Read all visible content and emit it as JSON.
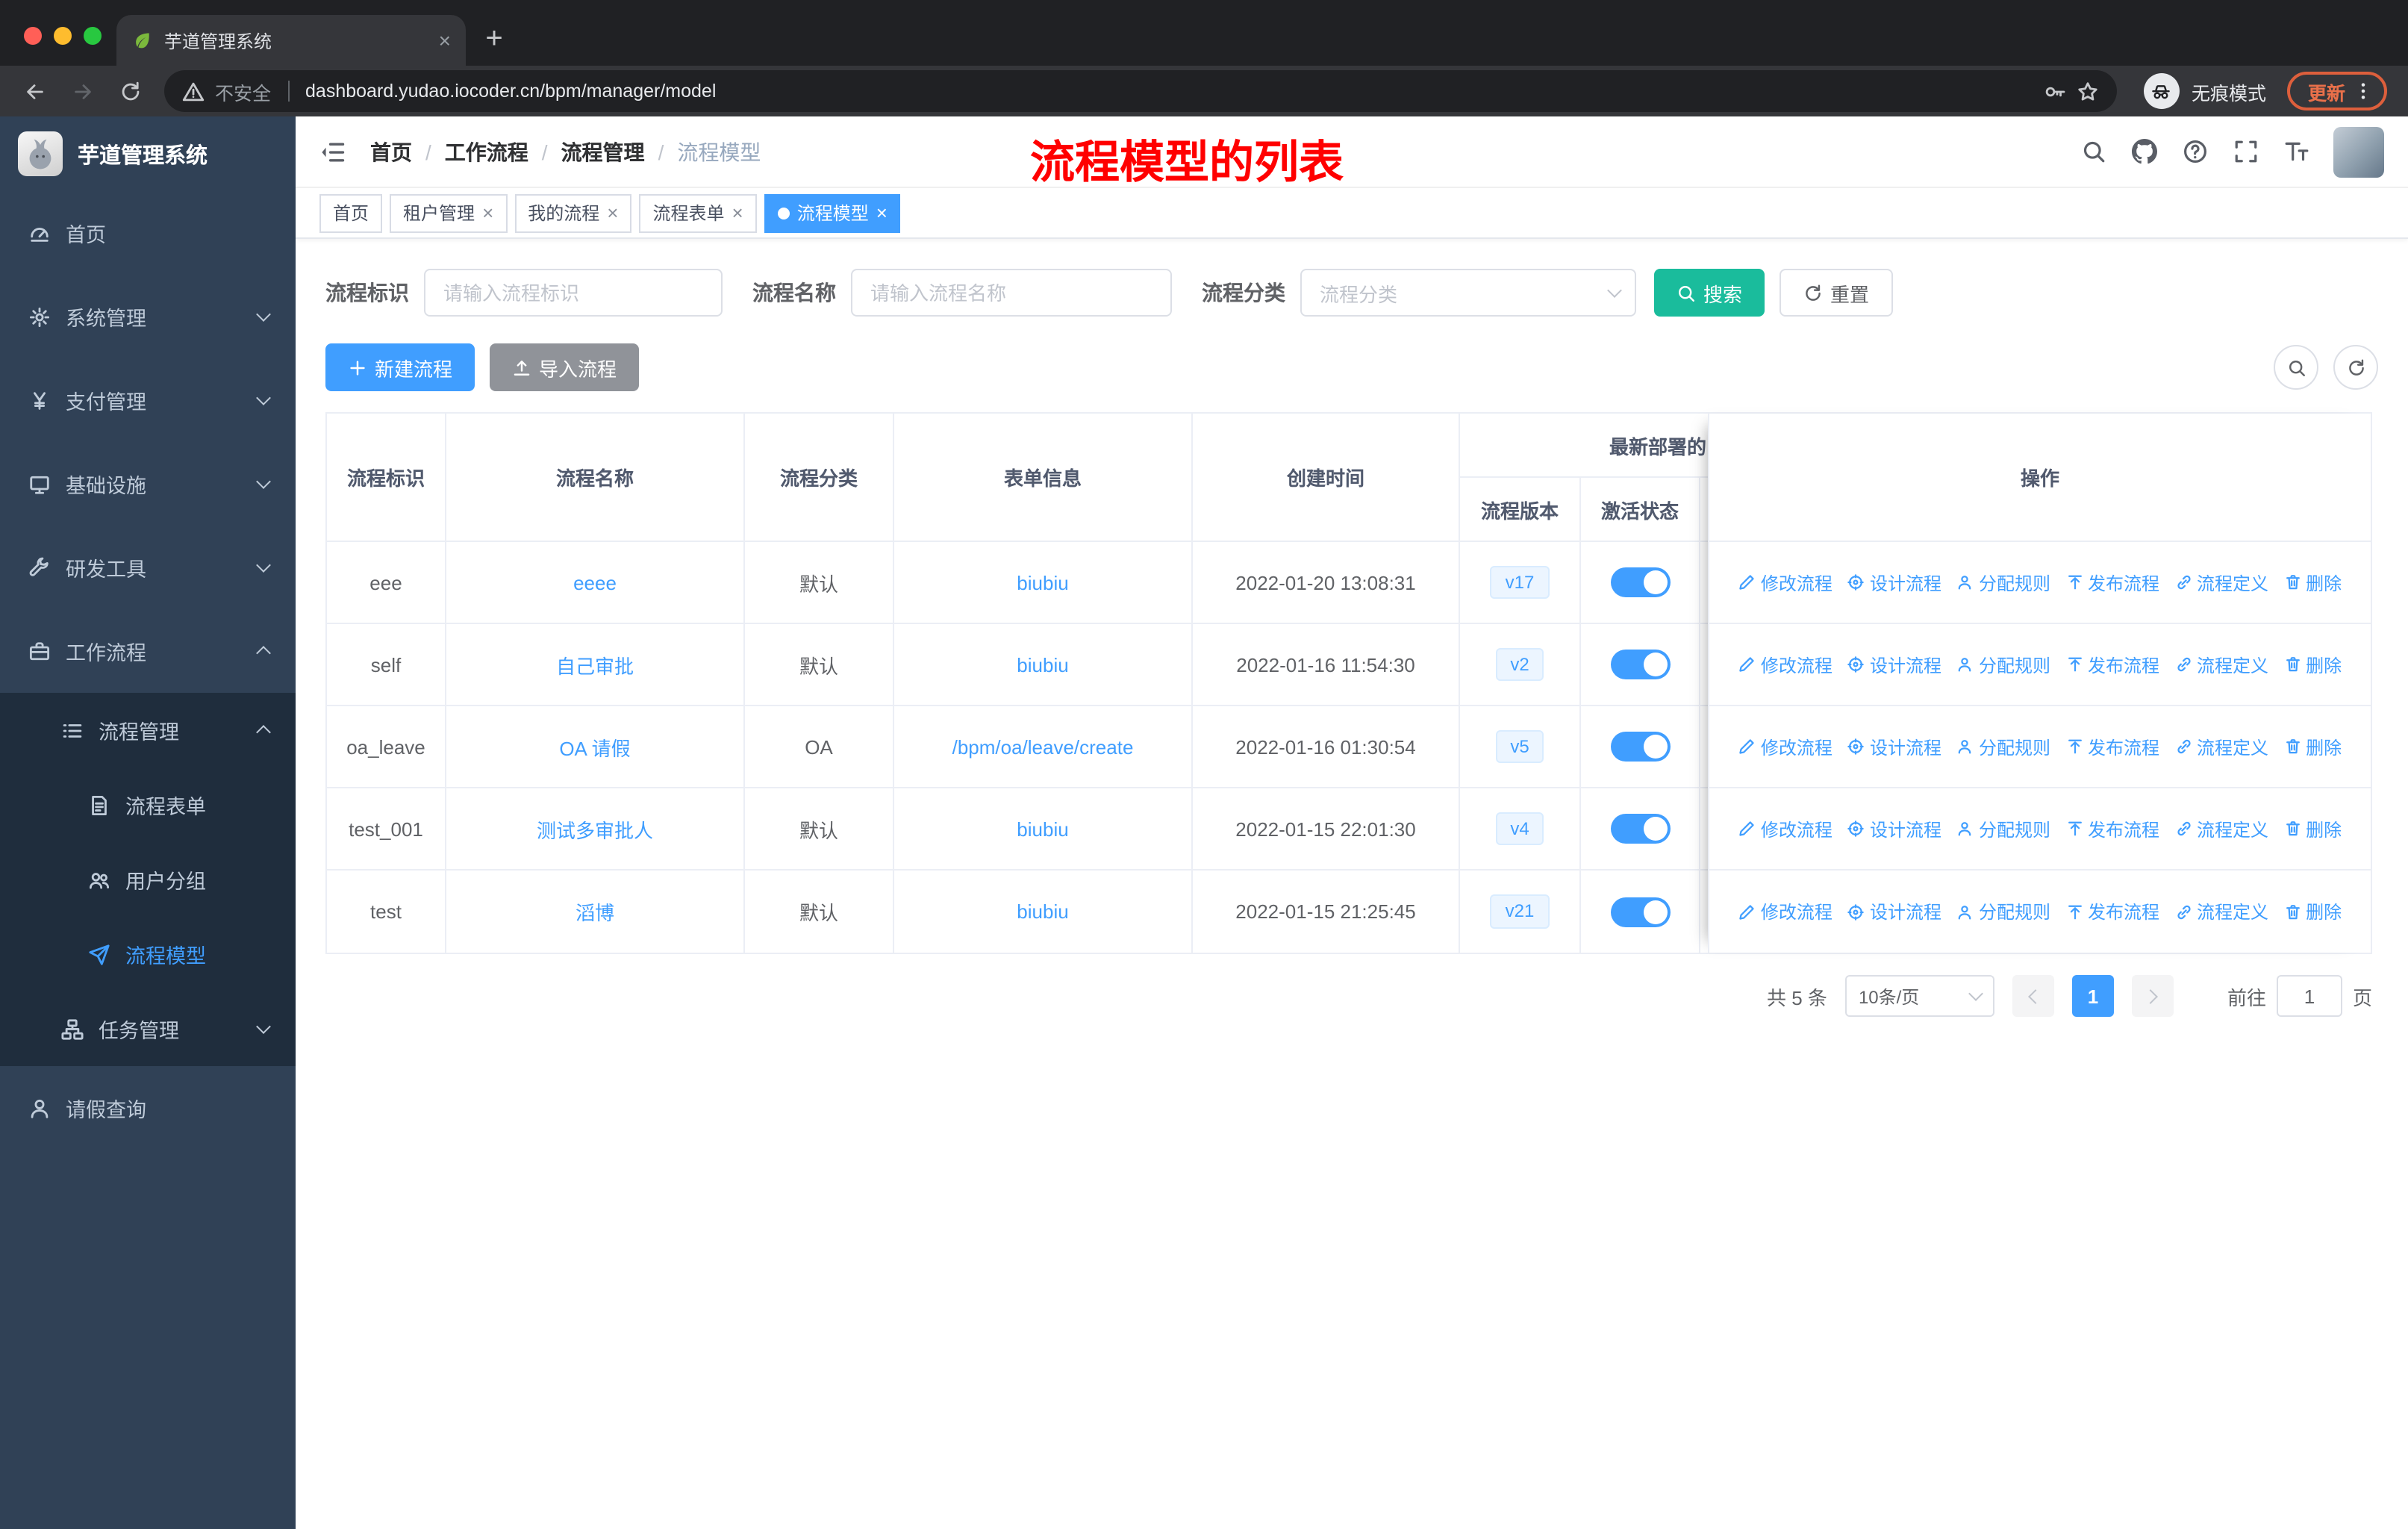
{
  "browser": {
    "tab_title": "芋道管理系统",
    "security_label": "不安全",
    "url": "dashboard.yudao.iocoder.cn/bpm/manager/model",
    "incognito_label": "无痕模式",
    "update_label": "更新"
  },
  "sidebar": {
    "title": "芋道管理系统",
    "menu": [
      {
        "name": "home",
        "label": "首页",
        "icon": "dashboard-icon",
        "level": 1
      },
      {
        "name": "system-management",
        "label": "系统管理",
        "icon": "gear-icon",
        "level": 1,
        "chevron": "down"
      },
      {
        "name": "payment-management",
        "label": "支付管理",
        "icon": "yen-icon",
        "level": 1,
        "chevron": "down"
      },
      {
        "name": "infrastructure",
        "label": "基础设施",
        "icon": "monitor-icon",
        "level": 1,
        "chevron": "down"
      },
      {
        "name": "dev-tools",
        "label": "研发工具",
        "icon": "wrench-icon",
        "level": 1,
        "chevron": "down"
      },
      {
        "name": "workflow",
        "label": "工作流程",
        "icon": "briefcase-icon",
        "level": 1,
        "chevron": "up"
      },
      {
        "name": "process-management",
        "label": "流程管理",
        "icon": "list-icon",
        "level": 2,
        "chevron": "up",
        "dark": true
      },
      {
        "name": "process-form",
        "label": "流程表单",
        "icon": "document-icon",
        "level": 3,
        "dark": true
      },
      {
        "name": "user-group",
        "label": "用户分组",
        "icon": "users-icon",
        "level": 3,
        "dark": true
      },
      {
        "name": "process-model",
        "label": "流程模型",
        "icon": "paper-plane-icon",
        "level": 3,
        "dark": true,
        "active": true
      },
      {
        "name": "task-management",
        "label": "任务管理",
        "icon": "tree-icon",
        "level": 2,
        "chevron": "down",
        "dark": true
      },
      {
        "name": "leave-query",
        "label": "请假查询",
        "icon": "user-icon",
        "level": 1
      }
    ]
  },
  "navbar": {
    "separator": "/",
    "breadcrumb": [
      {
        "label": "首页"
      },
      {
        "label": "工作流程"
      },
      {
        "label": "流程管理"
      },
      {
        "label": "流程模型",
        "current": true
      }
    ],
    "annotation": "流程模型的列表",
    "icons": [
      "search-icon",
      "github-icon",
      "help-icon",
      "fullscreen-icon",
      "font-size-icon"
    ]
  },
  "tags": [
    {
      "name": "home",
      "label": "首页",
      "closable": false
    },
    {
      "name": "tenant-management",
      "label": "租户管理",
      "closable": true
    },
    {
      "name": "my-process",
      "label": "我的流程",
      "closable": true
    },
    {
      "name": "process-form",
      "label": "流程表单",
      "closable": true
    },
    {
      "name": "process-model",
      "label": "流程模型",
      "closable": true,
      "active": true
    }
  ],
  "filters": {
    "fields": [
      {
        "label": "流程标识",
        "placeholder": "请输入流程标识",
        "type": "input"
      },
      {
        "label": "流程名称",
        "placeholder": "请输入流程名称",
        "type": "input"
      },
      {
        "label": "流程分类",
        "placeholder": "流程分类",
        "type": "select"
      }
    ],
    "search_label": "搜索",
    "reset_label": "重置"
  },
  "toolbar": {
    "create_label": "新建流程",
    "import_label": "导入流程"
  },
  "table": {
    "columns": [
      "流程标识",
      "流程名称",
      "流程分类",
      "表单信息",
      "创建时间",
      "流程版本",
      "激活状态",
      "操作"
    ],
    "group_header": "最新部署的",
    "actions": [
      {
        "name": "edit",
        "label": "修改流程",
        "icon": "edit-icon"
      },
      {
        "name": "design",
        "label": "设计流程",
        "icon": "design-icon"
      },
      {
        "name": "assign-rule",
        "label": "分配规则",
        "icon": "assign-icon"
      },
      {
        "name": "publish",
        "label": "发布流程",
        "icon": "publish-icon"
      },
      {
        "name": "definition",
        "label": "流程定义",
        "icon": "link-icon"
      },
      {
        "name": "delete",
        "label": "删除",
        "icon": "trash-icon"
      }
    ],
    "rows": [
      {
        "key": "eee",
        "name": "eeee",
        "category": "默认",
        "form": "biubiu",
        "created": "2022-01-20 13:08:31",
        "version": "v17",
        "active": true
      },
      {
        "key": "self",
        "name": "自己审批",
        "category": "默认",
        "form": "biubiu",
        "created": "2022-01-16 11:54:30",
        "version": "v2",
        "active": true
      },
      {
        "key": "oa_leave",
        "name": "OA 请假",
        "category": "OA",
        "form": "/bpm/oa/leave/create",
        "created": "2022-01-16 01:30:54",
        "version": "v5",
        "active": true
      },
      {
        "key": "test_001",
        "name": "测试多审批人",
        "category": "默认",
        "form": "biubiu",
        "created": "2022-01-15 22:01:30",
        "version": "v4",
        "active": true
      },
      {
        "key": "test",
        "name": "滔博",
        "category": "默认",
        "form": "biubiu",
        "created": "2022-01-15 21:25:45",
        "version": "v21",
        "active": true
      }
    ]
  },
  "pagination": {
    "total_label": "共 5 条",
    "page_size": "10条/页",
    "current_page": "1",
    "goto_label": "前往",
    "goto_value": "1",
    "page_suffix": "页"
  },
  "colors": {
    "primary": "#409eff",
    "search_button": "#1abc9c",
    "sidebar_bg": "#304156",
    "submenu_bg": "#1f2d3d",
    "annotation": "#ff0000"
  }
}
